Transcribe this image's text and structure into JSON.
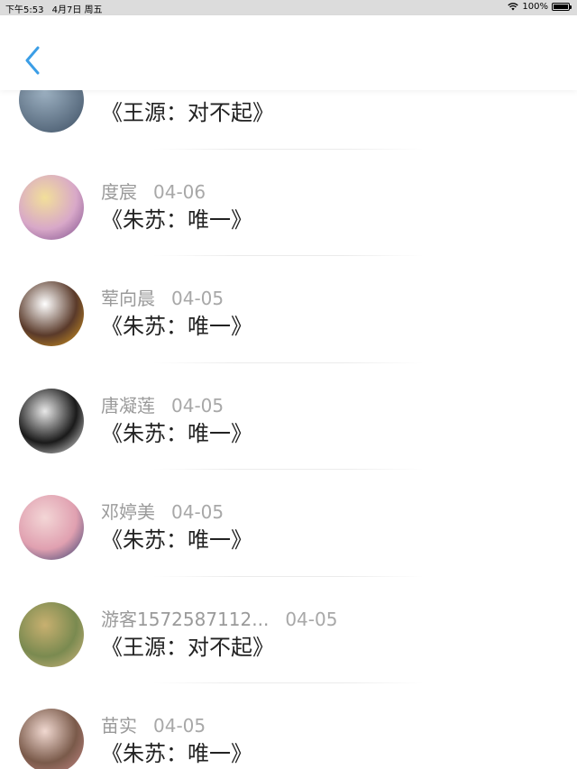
{
  "status_bar": {
    "time": "下午5:53",
    "date": "4月7日 周五",
    "battery_text": "100%",
    "battery_level": 1.0
  },
  "nav": {
    "back_icon": "chevron-left-icon",
    "accent_color": "#3b9ee6"
  },
  "comments": [
    {
      "name": "",
      "date": "",
      "text": "《王源：对不起》",
      "avatar_colors": [
        "#9fb3c4",
        "#3d4f63"
      ]
    },
    {
      "name": "度宸",
      "date": "04-06",
      "text": "《朱苏：唯一》",
      "avatar_colors": [
        "#f2df9a",
        "#d8a8c8",
        "#7a4a8a"
      ]
    },
    {
      "name": "荤向晨",
      "date": "04-05",
      "text": "《朱苏：唯一》",
      "avatar_colors": [
        "#ffffff",
        "#5a3a2a",
        "#e0a020"
      ]
    },
    {
      "name": "唐凝莲",
      "date": "04-05",
      "text": "《朱苏：唯一》",
      "avatar_colors": [
        "#e8e8e8",
        "#1a1a1a",
        "#f6f6f6"
      ]
    },
    {
      "name": "邓婷美",
      "date": "04-05",
      "text": "《朱苏：唯一》",
      "avatar_colors": [
        "#f3d6d6",
        "#e0a0b0",
        "#2d3a6e"
      ]
    },
    {
      "name": "游客1572587112...",
      "date": "04-05",
      "text": "《王源：对不起》",
      "avatar_colors": [
        "#c8b070",
        "#7a8a50",
        "#d4b880"
      ]
    },
    {
      "name": "苗实",
      "date": "04-05",
      "text": "《朱苏：唯一》",
      "avatar_colors": [
        "#f0d8d0",
        "#7a5a4a",
        "#c98a8a"
      ]
    }
  ]
}
